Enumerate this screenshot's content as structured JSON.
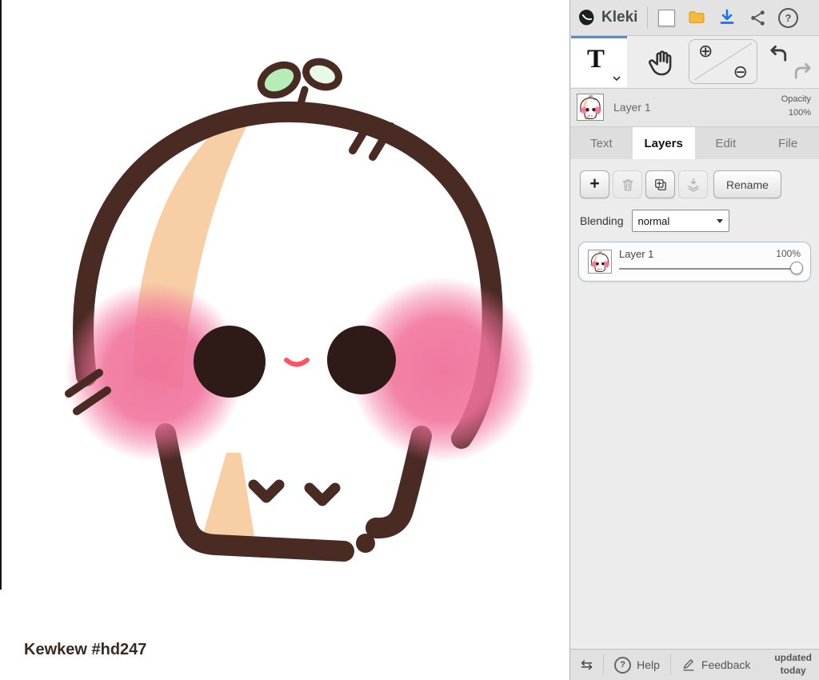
{
  "app": {
    "title": "Kleki"
  },
  "canvas": {
    "signature": "Kewkew #hd247"
  },
  "topbar": {
    "logo_label": "Kleki",
    "help_glyph": "?"
  },
  "toolbar": {
    "text_tool_label": "T",
    "zoom_in_glyph": "⊕",
    "zoom_out_glyph": "⊖"
  },
  "layer_preview": {
    "name": "Layer 1",
    "opacity_label": "Opacity",
    "opacity_value": "100%"
  },
  "tabs": [
    {
      "label": "Text",
      "active": false
    },
    {
      "label": "Layers",
      "active": true
    },
    {
      "label": "Edit",
      "active": false
    },
    {
      "label": "File",
      "active": false
    }
  ],
  "layers_panel": {
    "add_label": "+",
    "rename_label": "Rename",
    "blending_label": "Blending",
    "blending_value": "normal",
    "layers": [
      {
        "name": "Layer 1",
        "opacity": "100%"
      }
    ]
  },
  "bottombar": {
    "swap_glyph": "⇆",
    "help_glyph": "?",
    "help_label": "Help",
    "feedback_label": "Feedback",
    "updated_line1": "updated",
    "updated_line2": "today"
  },
  "colors": {
    "accent_blue": "#1a73e8",
    "selected_tool_blue": "#4b8df0",
    "folder_yellow": "#f6b93c",
    "outline_brown": "#4a2b24",
    "blush_pink": "#f0719b",
    "shade_peach": "#f8cfa4",
    "leaf_green": "#b5ecb8",
    "eye_brown": "#2e1a17",
    "mouth_red": "#ff5262"
  }
}
